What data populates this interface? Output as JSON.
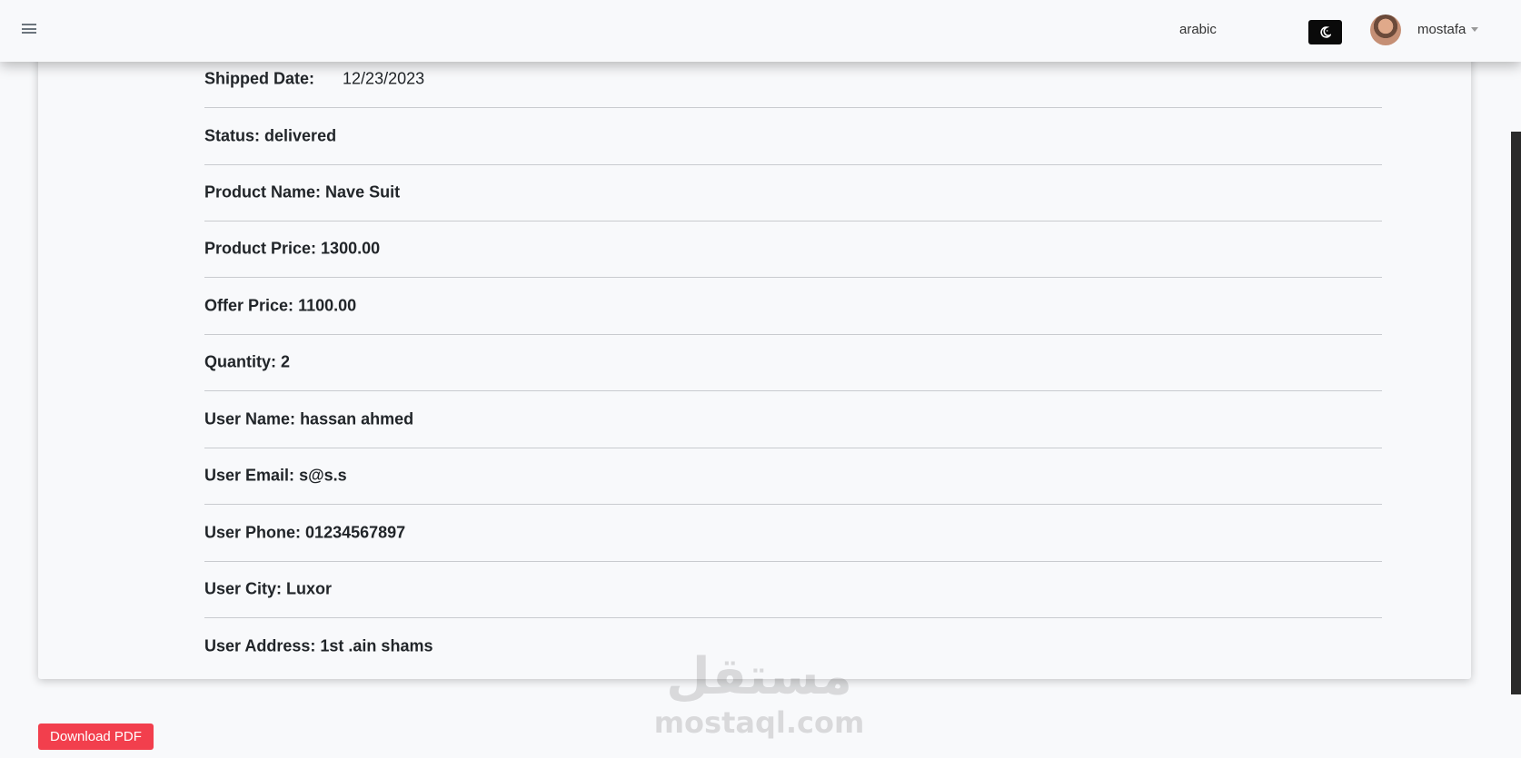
{
  "navbar": {
    "language_link": "arabic",
    "theme_icon": "moon-icon",
    "user_name": "mostafa",
    "menu_icon": "hamburger-menu-icon"
  },
  "order": {
    "shipped_label": "Shipped Date:",
    "shipped_value": "12/23/2023",
    "rows": [
      {
        "label": "Status:",
        "value": "delivered"
      },
      {
        "label": "Product Name:",
        "value": "Nave Suit"
      },
      {
        "label": "Product Price:",
        "value": "1300.00"
      },
      {
        "label": "Offer Price:",
        "value": "1100.00"
      },
      {
        "label": "Quantity:",
        "value": "2"
      },
      {
        "label": "User Name:",
        "value": "hassan ahmed"
      },
      {
        "label": "User Email:",
        "value": "s@s.s"
      },
      {
        "label": "User Phone:",
        "value": "01234567897"
      },
      {
        "label": "User City:",
        "value": "Luxor"
      },
      {
        "label": "User Address:",
        "value": "1st .ain shams"
      }
    ]
  },
  "actions": {
    "download_pdf": "Download PDF"
  },
  "watermark": {
    "mark": "مستقل",
    "text": "mostaql.com"
  },
  "colors": {
    "danger": "#f23f4d",
    "toggle_bg": "#0a0a0a"
  }
}
